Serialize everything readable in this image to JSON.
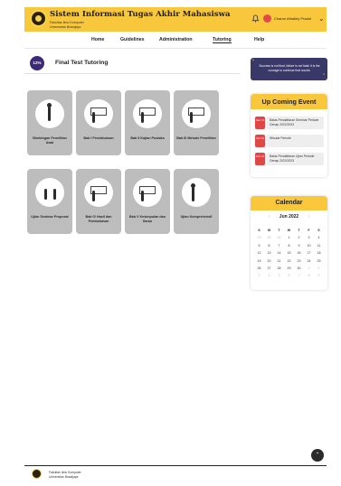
{
  "header": {
    "title": "Sistem Informasi Tugas Akhir Mahasiswa",
    "subtitle_line1": "Fakultas Ilmu Komputer",
    "subtitle_line2": "Universitas Brawijaya",
    "user_name": "Charon Athalley Pradol",
    "bell_icon": "bell-icon",
    "avatar_color": "#e24a4a",
    "accent": "#f9c73c"
  },
  "nav": {
    "items": [
      "Home",
      "Guidelines",
      "Administration",
      "Tutoring",
      "Help"
    ],
    "active": "Tutoring"
  },
  "course": {
    "progress": "12%",
    "title": "Final Test Tutoring"
  },
  "tiles": [
    {
      "label": "Bimbingan Penelitian Awal"
    },
    {
      "label": "Bab I Pendahuluan"
    },
    {
      "label": "Bab II Kajian Pustaka"
    },
    {
      "label": "Bab III Metode Penelitian"
    },
    {
      "label": "Ujian Seminar Proposal"
    },
    {
      "label": "Bab IV Hasil dan Pembahasan"
    },
    {
      "label": "Bab V Kesimpulan dan Saran"
    },
    {
      "label": "Ujian Komprehensif"
    }
  ],
  "quote": {
    "text": "Success is not final, failure is not fatal: it is the courage to continue that counts."
  },
  "events": {
    "title": "Up Coming Event",
    "items": [
      {
        "date": "Sen 11",
        "text": "Batas Pendaftaran Seminar Periode Genap 2022/2023"
      },
      {
        "date": "Sel 14",
        "text": "Wisuda Periode"
      },
      {
        "date": "Jum 17",
        "text": "Batas Pendaftaran Ujian Periode Genap 2022/2023"
      }
    ]
  },
  "calendar": {
    "title": "Calendar",
    "month": "Jun 2022",
    "days": [
      "S",
      "M",
      "T",
      "W",
      "T",
      "F",
      "S"
    ],
    "weeks": [
      [
        "29",
        "30",
        "31",
        "1",
        "2",
        "3",
        "4"
      ],
      [
        "5",
        "6",
        "7",
        "8",
        "9",
        "10",
        "11"
      ],
      [
        "12",
        "13",
        "14",
        "15",
        "16",
        "17",
        "18"
      ],
      [
        "19",
        "20",
        "21",
        "22",
        "23",
        "24",
        "25"
      ],
      [
        "26",
        "27",
        "28",
        "29",
        "30",
        "1",
        "2"
      ],
      [
        "3",
        "4",
        "5",
        "6",
        "7",
        "8",
        "9"
      ]
    ]
  },
  "footer": {
    "line1": "Fakultas Ilmu Komputer",
    "line2": "Universitas Brawijaya"
  }
}
